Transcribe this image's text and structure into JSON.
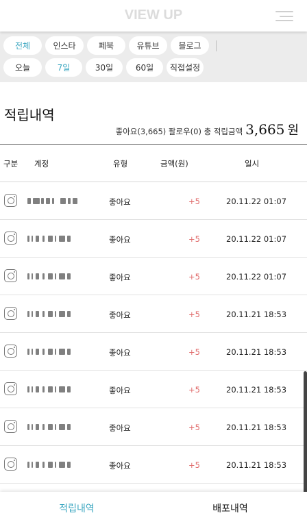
{
  "header": {
    "logo": "VIEW UP"
  },
  "filters": {
    "platforms": [
      {
        "label": "전체",
        "active": true
      },
      {
        "label": "인스타",
        "active": false
      },
      {
        "label": "페북",
        "active": false
      },
      {
        "label": "유튜브",
        "active": false
      },
      {
        "label": "블로그",
        "active": false
      }
    ],
    "periods": [
      {
        "label": "오늘",
        "active": false
      },
      {
        "label": "7일",
        "active": true
      },
      {
        "label": "30일",
        "active": false
      },
      {
        "label": "60일",
        "active": false
      },
      {
        "label": "직접설정",
        "active": false
      }
    ]
  },
  "main": {
    "title": "적립내역",
    "summary_label": "좋아요(3,665) 팔로우(0) 총 적립금액",
    "summary_amount": "3,665",
    "summary_unit": "원"
  },
  "table": {
    "headers": [
      "구분",
      "계정",
      "유형",
      "금액(원)",
      "일시"
    ],
    "rows": [
      {
        "type": "좋아요",
        "amount": "+5",
        "date": "20.11.22 01:07"
      },
      {
        "type": "좋아요",
        "amount": "+5",
        "date": "20.11.22 01:07"
      },
      {
        "type": "좋아요",
        "amount": "+5",
        "date": "20.11.22 01:07"
      },
      {
        "type": "좋아요",
        "amount": "+5",
        "date": "20.11.21 18:53"
      },
      {
        "type": "좋아요",
        "amount": "+5",
        "date": "20.11.21 18:53"
      },
      {
        "type": "좋아요",
        "amount": "+5",
        "date": "20.11.21 18:53"
      },
      {
        "type": "좋아요",
        "amount": "+5",
        "date": "20.11.21 18:53"
      },
      {
        "type": "좋아요",
        "amount": "+5",
        "date": "20.11.21 18:53"
      }
    ]
  },
  "tabs": [
    {
      "label": "적립내역",
      "active": true
    },
    {
      "label": "배포내역",
      "active": false
    }
  ],
  "colors": {
    "accent": "#3aa6c0",
    "amount": "#e06a6a",
    "filter_bg": "#ececec"
  },
  "icons": {
    "row_icon": "instagram-icon",
    "menu": "hamburger-menu-icon"
  }
}
